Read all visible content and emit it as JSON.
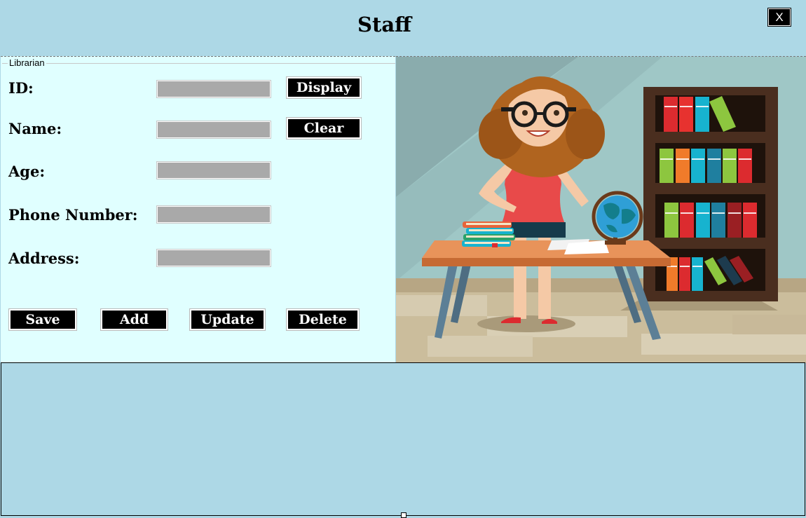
{
  "window": {
    "title": "Staff",
    "close_label": "X"
  },
  "form": {
    "group_label": "Librarian",
    "fields": [
      {
        "label": "ID:",
        "value": ""
      },
      {
        "label": "Name:",
        "value": ""
      },
      {
        "label": "Age:",
        "value": ""
      },
      {
        "label": "Phone Number:",
        "value": ""
      },
      {
        "label": "Address:",
        "value": ""
      }
    ],
    "buttons": {
      "display": "Display",
      "clear": "Clear",
      "save": "Save",
      "add": "Add",
      "update": "Update",
      "delete": "Delete"
    }
  },
  "illustration": {
    "icon": "librarian-illustration"
  },
  "colors": {
    "header_bg": "#add8e6",
    "panel_bg": "#e0ffff",
    "field_bg": "#a9a9a9",
    "button_bg": "#000000"
  }
}
